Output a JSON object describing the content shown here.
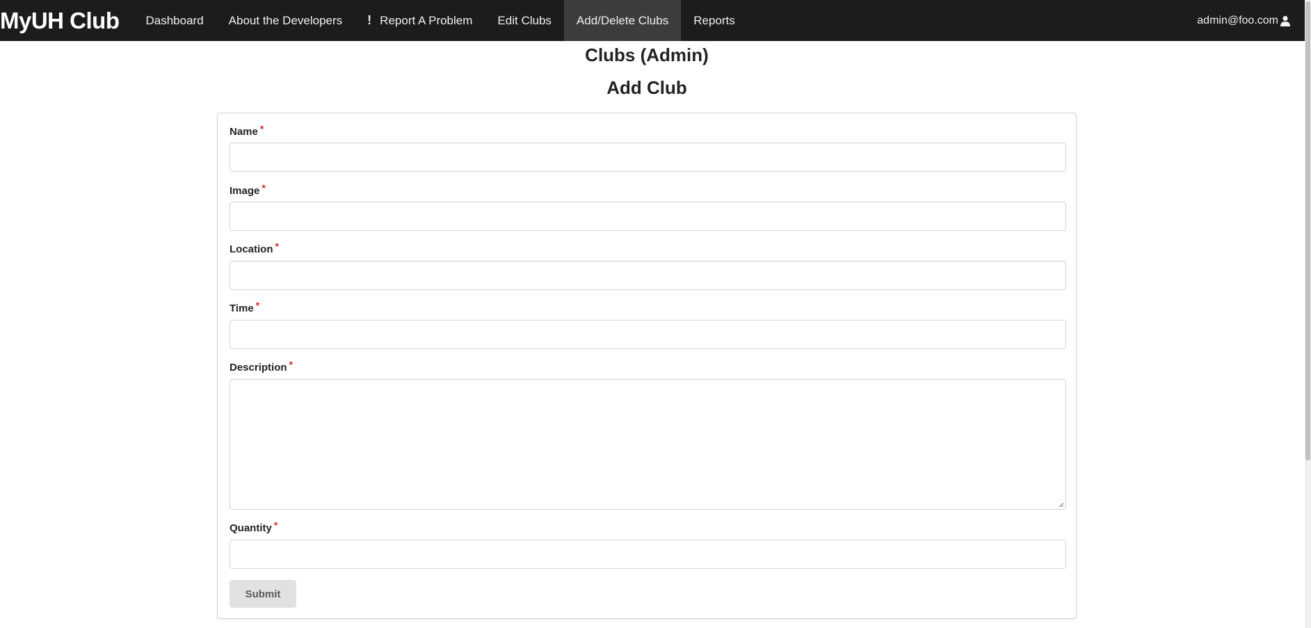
{
  "navbar": {
    "brand": "MyUH Club",
    "items": [
      {
        "label": "Dashboard"
      },
      {
        "label": "About the Developers"
      },
      {
        "label": "Report A Problem",
        "icon": "exclamation-icon"
      },
      {
        "label": "Edit Clubs"
      },
      {
        "label": "Add/Delete Clubs",
        "active": true
      },
      {
        "label": "Reports"
      }
    ],
    "user": "admin@foo.com",
    "user_icon": "user-icon"
  },
  "page": {
    "title": "Clubs (Admin)",
    "form_title": "Add Club"
  },
  "form": {
    "fields": [
      {
        "label": "Name",
        "required": "*",
        "value": ""
      },
      {
        "label": "Image",
        "required": "*",
        "value": ""
      },
      {
        "label": "Location",
        "required": "*",
        "value": ""
      },
      {
        "label": "Time",
        "required": "*",
        "value": ""
      },
      {
        "label": "Description",
        "required": "*",
        "value": ""
      },
      {
        "label": "Quantity",
        "required": "*",
        "value": ""
      }
    ],
    "submit_label": "Submit"
  },
  "colors": {
    "navbar_bg": "#1b1c1d",
    "active_item_bg": "#3c3c3d",
    "required_marker": "#db2828",
    "button_bg": "#e0e1e2"
  }
}
